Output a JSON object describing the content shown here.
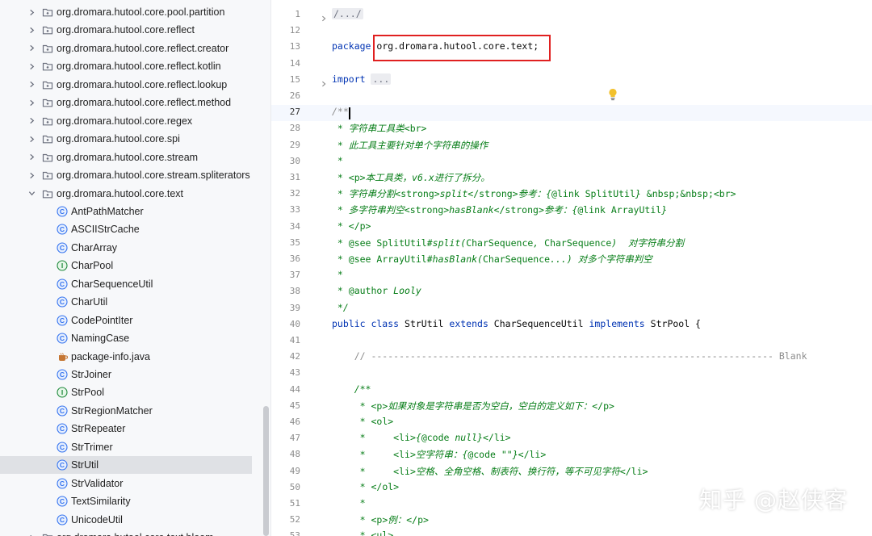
{
  "project_tree": {
    "rows": [
      {
        "label": "org.dromara.hutool.core.pool.partition",
        "kind": "package",
        "expanded": false
      },
      {
        "label": "org.dromara.hutool.core.reflect",
        "kind": "package",
        "expanded": false
      },
      {
        "label": "org.dromara.hutool.core.reflect.creator",
        "kind": "package",
        "expanded": false
      },
      {
        "label": "org.dromara.hutool.core.reflect.kotlin",
        "kind": "package",
        "expanded": false
      },
      {
        "label": "org.dromara.hutool.core.reflect.lookup",
        "kind": "package",
        "expanded": false
      },
      {
        "label": "org.dromara.hutool.core.reflect.method",
        "kind": "package",
        "expanded": false
      },
      {
        "label": "org.dromara.hutool.core.regex",
        "kind": "package",
        "expanded": false
      },
      {
        "label": "org.dromara.hutool.core.spi",
        "kind": "package",
        "expanded": false
      },
      {
        "label": "org.dromara.hutool.core.stream",
        "kind": "package",
        "expanded": false
      },
      {
        "label": "org.dromara.hutool.core.stream.spliterators",
        "kind": "package",
        "expanded": false
      },
      {
        "label": "org.dromara.hutool.core.text",
        "kind": "package",
        "expanded": true
      },
      {
        "label": "AntPathMatcher",
        "kind": "class"
      },
      {
        "label": "ASCIIStrCache",
        "kind": "class"
      },
      {
        "label": "CharArray",
        "kind": "class"
      },
      {
        "label": "CharPool",
        "kind": "interface"
      },
      {
        "label": "CharSequenceUtil",
        "kind": "class"
      },
      {
        "label": "CharUtil",
        "kind": "class"
      },
      {
        "label": "CodePointIter",
        "kind": "class"
      },
      {
        "label": "NamingCase",
        "kind": "class"
      },
      {
        "label": "package-info.java",
        "kind": "java-file"
      },
      {
        "label": "StrJoiner",
        "kind": "class"
      },
      {
        "label": "StrPool",
        "kind": "interface"
      },
      {
        "label": "StrRegionMatcher",
        "kind": "class"
      },
      {
        "label": "StrRepeater",
        "kind": "class"
      },
      {
        "label": "StrTrimer",
        "kind": "class"
      },
      {
        "label": "StrUtil",
        "kind": "class",
        "selected": true
      },
      {
        "label": "StrValidator",
        "kind": "class"
      },
      {
        "label": "TextSimilarity",
        "kind": "class"
      },
      {
        "label": "UnicodeUtil",
        "kind": "class"
      },
      {
        "label": "org.dromara.hutool.core.text.bloom",
        "kind": "package",
        "expanded": false
      }
    ]
  },
  "editor": {
    "current_line": "27",
    "lines": [
      {
        "n": "1",
        "segs": [
          {
            "t": "/.../",
            "c": "fold"
          }
        ]
      },
      {
        "n": "12",
        "segs": []
      },
      {
        "n": "13",
        "segs": [
          {
            "t": "package ",
            "c": "kw"
          },
          {
            "t": "org.dromara.hutool.core.text;",
            "c": ""
          }
        ]
      },
      {
        "n": "14",
        "segs": []
      },
      {
        "n": "15",
        "segs": [
          {
            "t": "import ",
            "c": "kw"
          },
          {
            "t": "...",
            "c": "fold"
          }
        ]
      },
      {
        "n": "26",
        "segs": []
      },
      {
        "n": "27",
        "segs": [
          {
            "t": "/**",
            "c": "cmi"
          }
        ]
      },
      {
        "n": "28",
        "segs": [
          {
            "t": " * 字符串工具类",
            "c": "dgi"
          },
          {
            "t": "<br>",
            "c": "dg"
          }
        ]
      },
      {
        "n": "29",
        "segs": [
          {
            "t": " * 此工具主要针对单个字符串的操作",
            "c": "dgi"
          }
        ]
      },
      {
        "n": "30",
        "segs": [
          {
            "t": " *",
            "c": "dgi"
          }
        ]
      },
      {
        "n": "31",
        "segs": [
          {
            "t": " * ",
            "c": "dgi"
          },
          {
            "t": "<p>",
            "c": "dg"
          },
          {
            "t": "本工具类，v6.x进行了拆分。",
            "c": "dgi"
          }
        ]
      },
      {
        "n": "32",
        "segs": [
          {
            "t": " * 字符串分割",
            "c": "dgi"
          },
          {
            "t": "<strong>",
            "c": "dg"
          },
          {
            "t": "split",
            "c": "dgi"
          },
          {
            "t": "</strong>",
            "c": "dg"
          },
          {
            "t": "参考：{",
            "c": "dgi"
          },
          {
            "t": "@link",
            "c": "dg"
          },
          {
            "t": " SplitUtil",
            "c": "dg"
          },
          {
            "t": "} ",
            "c": "dgi"
          },
          {
            "t": "&nbsp;&nbsp;<br>",
            "c": "dg"
          }
        ]
      },
      {
        "n": "33",
        "segs": [
          {
            "t": " * 多字符串判空",
            "c": "dgi"
          },
          {
            "t": "<strong>",
            "c": "dg"
          },
          {
            "t": "hasBlank",
            "c": "dgi"
          },
          {
            "t": "</strong>",
            "c": "dg"
          },
          {
            "t": "参考：{",
            "c": "dgi"
          },
          {
            "t": "@link",
            "c": "dg"
          },
          {
            "t": " ArrayUtil",
            "c": "dg"
          },
          {
            "t": "}",
            "c": "dgi"
          }
        ]
      },
      {
        "n": "34",
        "segs": [
          {
            "t": " * ",
            "c": "dgi"
          },
          {
            "t": "</p>",
            "c": "dg"
          }
        ]
      },
      {
        "n": "35",
        "segs": [
          {
            "t": " * ",
            "c": "dgi"
          },
          {
            "t": "@see",
            "c": "dg"
          },
          {
            "t": " SplitUtil",
            "c": "dg"
          },
          {
            "t": "#split(",
            "c": "dgi"
          },
          {
            "t": "CharSequence",
            "c": "dg"
          },
          {
            "t": ", ",
            "c": "dgi"
          },
          {
            "t": "CharSequence",
            "c": "dg"
          },
          {
            "t": ")  对字符串分割",
            "c": "dgi"
          }
        ]
      },
      {
        "n": "36",
        "segs": [
          {
            "t": " * ",
            "c": "dgi"
          },
          {
            "t": "@see",
            "c": "dg"
          },
          {
            "t": " ArrayUtil",
            "c": "dg"
          },
          {
            "t": "#hasBlank(",
            "c": "dgi"
          },
          {
            "t": "CharSequence",
            "c": "dg"
          },
          {
            "t": "...) 对多个字符串判空",
            "c": "dgi"
          }
        ]
      },
      {
        "n": "37",
        "segs": [
          {
            "t": " *",
            "c": "dgi"
          }
        ]
      },
      {
        "n": "38",
        "segs": [
          {
            "t": " * ",
            "c": "dgi"
          },
          {
            "t": "@author",
            "c": "dg"
          },
          {
            "t": " Looly",
            "c": "dgi"
          }
        ]
      },
      {
        "n": "39",
        "segs": [
          {
            "t": " */",
            "c": "dgi"
          }
        ]
      },
      {
        "n": "40",
        "segs": [
          {
            "t": "public class ",
            "c": "kw"
          },
          {
            "t": "StrUtil ",
            "c": ""
          },
          {
            "t": "extends ",
            "c": "kw"
          },
          {
            "t": "CharSequenceUtil ",
            "c": ""
          },
          {
            "t": "implements ",
            "c": "kw"
          },
          {
            "t": "StrPool {",
            "c": ""
          }
        ]
      },
      {
        "n": "41",
        "segs": []
      },
      {
        "n": "42",
        "segs": [
          {
            "t": "    // ------------------------------------------------------------------------ Blank",
            "c": "cm"
          }
        ]
      },
      {
        "n": "43",
        "segs": []
      },
      {
        "n": "44",
        "segs": [
          {
            "t": "    /**",
            "c": "dgi"
          }
        ]
      },
      {
        "n": "45",
        "segs": [
          {
            "t": "     * ",
            "c": "dgi"
          },
          {
            "t": "<p>",
            "c": "dg"
          },
          {
            "t": "如果对象是字符串是否为空白，空白的定义如下：",
            "c": "dgi"
          },
          {
            "t": "</p>",
            "c": "dg"
          }
        ]
      },
      {
        "n": "46",
        "segs": [
          {
            "t": "     * ",
            "c": "dgi"
          },
          {
            "t": "<ol>",
            "c": "dg"
          }
        ]
      },
      {
        "n": "47",
        "segs": [
          {
            "t": "     *     ",
            "c": "dgi"
          },
          {
            "t": "<li>",
            "c": "dg"
          },
          {
            "t": "{",
            "c": "dgi"
          },
          {
            "t": "@code",
            "c": "dg"
          },
          {
            "t": " null}",
            "c": "dgi"
          },
          {
            "t": "</li>",
            "c": "dg"
          }
        ]
      },
      {
        "n": "48",
        "segs": [
          {
            "t": "     *     ",
            "c": "dgi"
          },
          {
            "t": "<li>",
            "c": "dg"
          },
          {
            "t": "空字符串：{",
            "c": "dgi"
          },
          {
            "t": "@code",
            "c": "dg"
          },
          {
            "t": " \"\"}",
            "c": "dgi"
          },
          {
            "t": "</li>",
            "c": "dg"
          }
        ]
      },
      {
        "n": "49",
        "segs": [
          {
            "t": "     *     ",
            "c": "dgi"
          },
          {
            "t": "<li>",
            "c": "dg"
          },
          {
            "t": "空格、全角空格、制表符、换行符，等不可见字符",
            "c": "dgi"
          },
          {
            "t": "</li>",
            "c": "dg"
          }
        ]
      },
      {
        "n": "50",
        "segs": [
          {
            "t": "     * ",
            "c": "dgi"
          },
          {
            "t": "</ol>",
            "c": "dg"
          }
        ]
      },
      {
        "n": "51",
        "segs": [
          {
            "t": "     *",
            "c": "dgi"
          }
        ]
      },
      {
        "n": "52",
        "segs": [
          {
            "t": "     * ",
            "c": "dgi"
          },
          {
            "t": "<p>",
            "c": "dg"
          },
          {
            "t": "例：",
            "c": "dgi"
          },
          {
            "t": "</p>",
            "c": "dg"
          }
        ]
      },
      {
        "n": "53",
        "segs": [
          {
            "t": "     * ",
            "c": "dgi"
          },
          {
            "t": "<ul>",
            "c": "dg"
          }
        ]
      }
    ]
  },
  "watermark": "知乎 @赵侠客",
  "colors": {
    "keyword": "#0033b3",
    "doc_green": "#067d17",
    "highlight_box": "#e02020",
    "selected_row": "#dfe1e5"
  }
}
